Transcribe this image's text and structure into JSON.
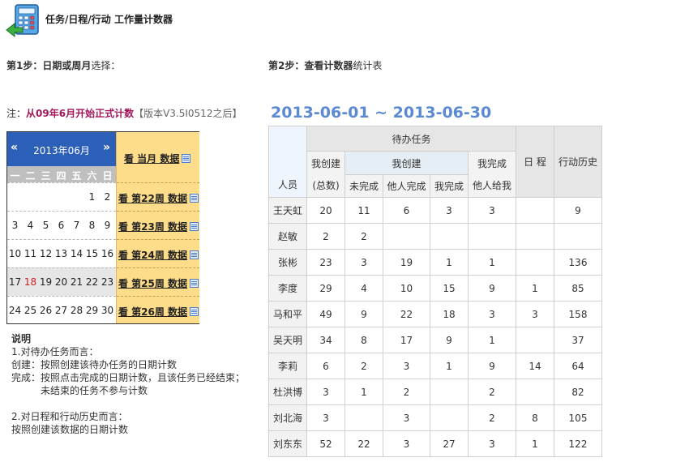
{
  "header": {
    "title": "任务/日程/行动 工作量计数器"
  },
  "steps": {
    "step1_bold": "第1步：日期或周月",
    "step1_rest": "选择：",
    "step2_bold": "第2步：查看计数器",
    "step2_rest": "统计表"
  },
  "note": {
    "prefix": "注：",
    "highlight": "从09年6月开始正式计数",
    "version": "【版本V3.5I0512之后】"
  },
  "calendar": {
    "prev": "«",
    "next": "»",
    "month": "2013年06月",
    "weekdays": [
      "一",
      "二",
      "三",
      "四",
      "五",
      "六",
      "日"
    ],
    "weeks": [
      [
        "",
        "",
        "",
        "",
        "",
        "1",
        "2"
      ],
      [
        "3",
        "4",
        "5",
        "6",
        "7",
        "8",
        "9"
      ],
      [
        "10",
        "11",
        "12",
        "13",
        "14",
        "15",
        "16"
      ],
      [
        "17",
        "18",
        "19",
        "20",
        "21",
        "22",
        "23"
      ],
      [
        "24",
        "25",
        "26",
        "27",
        "28",
        "29",
        "30"
      ]
    ],
    "month_link": "看 当月 数据",
    "week_links": [
      "看 第22周 数据",
      "看 第23周 数据",
      "看 第24周 数据",
      "看 第25周 数据",
      "看 第26周 数据"
    ]
  },
  "explain": {
    "title": "说明",
    "line1": "1.对待办任务而言：",
    "line2": "创建：按照创建该待办任务的日期计数",
    "line3": "完成：按照点击完成的日期计数，且该任务已经结束；",
    "line4": "未结束的任务不参与计数",
    "line5": "2.对日程和行动历史而言：",
    "line6": "按照创建该数据的日期计数"
  },
  "range": "2013-06-01 ~ 2013-06-30",
  "table": {
    "headers": {
      "person": "人员",
      "todo": "待办任务",
      "i_created": "我创建",
      "total_top": "我创建",
      "total_bottom": "(总数)",
      "unfinished": "未完成",
      "others_done": "他人完成",
      "i_done": "我完成",
      "i_finished_top": "我完成",
      "i_finished_bottom": "他人给我",
      "schedule": "日 程",
      "history": "行动历史"
    },
    "rows": [
      [
        "王天虹",
        "20",
        "11",
        "6",
        "3",
        "3",
        "",
        "9"
      ],
      [
        "赵敏",
        "2",
        "2",
        "",
        "",
        "",
        "",
        ""
      ],
      [
        "张彬",
        "23",
        "3",
        "19",
        "1",
        "1",
        "",
        "136"
      ],
      [
        "李度",
        "29",
        "4",
        "10",
        "15",
        "9",
        "1",
        "85"
      ],
      [
        "马和平",
        "49",
        "9",
        "22",
        "18",
        "3",
        "3",
        "158"
      ],
      [
        "吴天明",
        "34",
        "8",
        "17",
        "9",
        "1",
        "",
        "37"
      ],
      [
        "李莉",
        "6",
        "2",
        "3",
        "1",
        "9",
        "14",
        "64"
      ],
      [
        "杜洪博",
        "3",
        "1",
        "2",
        "",
        "2",
        "",
        "82"
      ],
      [
        "刘北海",
        "3",
        "",
        "3",
        "",
        "2",
        "8",
        "105"
      ],
      [
        "刘东东",
        "52",
        "22",
        "3",
        "27",
        "3",
        "1",
        "122"
      ]
    ]
  },
  "colors": {
    "accent": "#2c5fb8",
    "range_title": "#5b8ad2",
    "note_highlight": "#a0185a",
    "calendar_side": "#fddc8a"
  }
}
